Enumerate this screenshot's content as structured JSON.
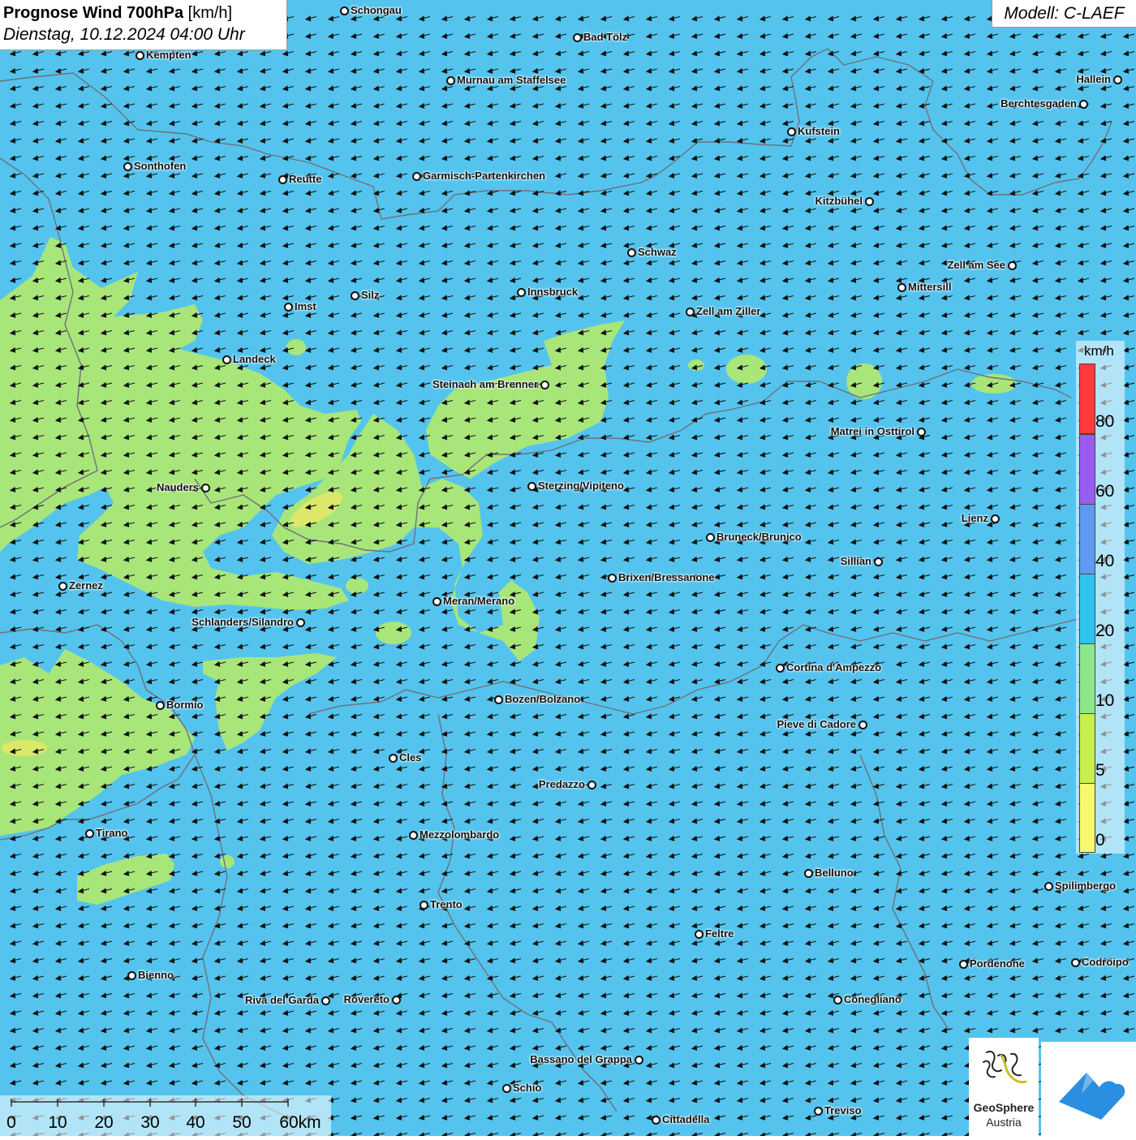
{
  "header": {
    "title_bold": "Prognose Wind 700hPa",
    "title_unit": "[km/h]",
    "datetime": "Dienstag, 10.12.2024 04:00 Uhr",
    "model": "Modell: C-LAEF"
  },
  "map": {
    "colors": {
      "background": "#54c4ee",
      "low_wind": "#a8e67a",
      "very_low": "#dde86a",
      "border": "#6f6f7a",
      "arrow": "#111111"
    },
    "wind_direction": "from east (arrows pointing west-southwest)"
  },
  "cities": [
    {
      "name": "Schongau"
    },
    {
      "name": "Bad Tölz"
    },
    {
      "name": "Kempten"
    },
    {
      "name": "Murnau am Staffelsee"
    },
    {
      "name": "Hallein"
    },
    {
      "name": "Berchtesgaden"
    },
    {
      "name": "Kufstein"
    },
    {
      "name": "Sonthofen"
    },
    {
      "name": "Reutte"
    },
    {
      "name": "Garmisch-Partenkirchen"
    },
    {
      "name": "Kitzbühel"
    },
    {
      "name": "Schwaz"
    },
    {
      "name": "Zell am See"
    },
    {
      "name": "Mittersill"
    },
    {
      "name": "Innsbruck"
    },
    {
      "name": "Silz"
    },
    {
      "name": "Imst"
    },
    {
      "name": "Zell am Ziller"
    },
    {
      "name": "Landeck"
    },
    {
      "name": "Steinach am Brenner"
    },
    {
      "name": "Matrei in Osttirol"
    },
    {
      "name": "Nauders"
    },
    {
      "name": "Sterzing/Vipiteno"
    },
    {
      "name": "Lienz"
    },
    {
      "name": "Bruneck/Brunico"
    },
    {
      "name": "Sillian"
    },
    {
      "name": "Zernez"
    },
    {
      "name": "Brixen/Bressanone"
    },
    {
      "name": "Meran/Merano"
    },
    {
      "name": "Schlanders/Silandro"
    },
    {
      "name": "Cortina d'Ampezzo"
    },
    {
      "name": "Bozen/Bolzano"
    },
    {
      "name": "Bormio"
    },
    {
      "name": "Pieve di Cadore"
    },
    {
      "name": "Cles"
    },
    {
      "name": "Predazzo"
    },
    {
      "name": "Tirano"
    },
    {
      "name": "Mezzolombardo"
    },
    {
      "name": "Belluno"
    },
    {
      "name": "Spilimbergo"
    },
    {
      "name": "Trento"
    },
    {
      "name": "Feltre"
    },
    {
      "name": "Pordenone"
    },
    {
      "name": "Codroipo"
    },
    {
      "name": "Bienno"
    },
    {
      "name": "Riva del Garda"
    },
    {
      "name": "Rovereto"
    },
    {
      "name": "Conegliano"
    },
    {
      "name": "Bassano del Grappa"
    },
    {
      "name": "Schio"
    },
    {
      "name": "Treviso"
    },
    {
      "name": "Cittadella"
    }
  ],
  "legend": {
    "unit": "km/h",
    "labels": [
      "80",
      "60",
      "40",
      "20",
      "10",
      "5",
      "0"
    ],
    "colors": [
      "#ff3a3a",
      "#9a5cf0",
      "#5f9af0",
      "#2fc4f0",
      "#8ee88a",
      "#c8ee50",
      "#f8f870"
    ]
  },
  "scale": {
    "labels": [
      "0",
      "10",
      "20",
      "30",
      "40",
      "50",
      "60km"
    ]
  },
  "logos": {
    "geosphere_line1": "GeoSphere",
    "geosphere_line2": "Austria"
  }
}
